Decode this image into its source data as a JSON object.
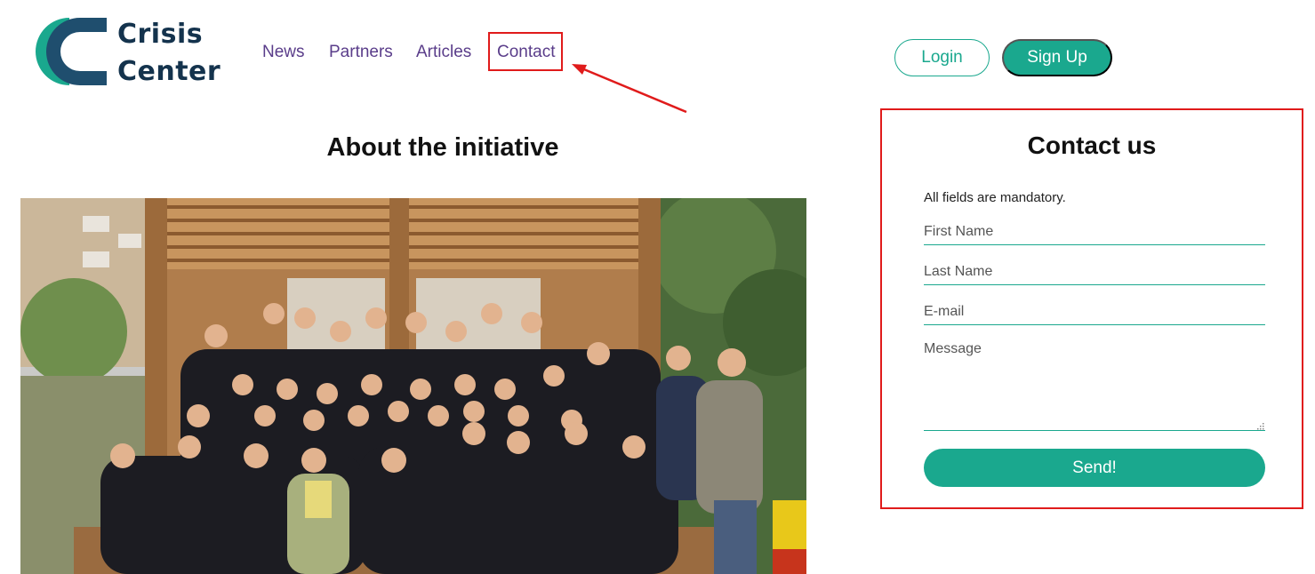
{
  "brand": {
    "name_line1": "Crisis",
    "name_line2": "Center",
    "color_dark": "#1f4e6e",
    "color_teal": "#1aa88e"
  },
  "nav": {
    "items": [
      {
        "label": "News"
      },
      {
        "label": "Partners"
      },
      {
        "label": "Articles"
      },
      {
        "label": "Contact"
      }
    ],
    "highlighted": "Contact"
  },
  "auth": {
    "login_label": "Login",
    "signup_label": "Sign Up"
  },
  "about": {
    "title": "About the initiative"
  },
  "contact": {
    "title": "Contact us",
    "mandatory_note": "All fields are mandatory.",
    "first_name_placeholder": "First Name",
    "last_name_placeholder": "Last Name",
    "email_placeholder": "E-mail",
    "message_placeholder": "Message",
    "send_label": "Send!"
  },
  "colors": {
    "accent": "#1aa88e",
    "nav_text": "#5a3d8a",
    "annotation_red": "#e01b1b"
  }
}
